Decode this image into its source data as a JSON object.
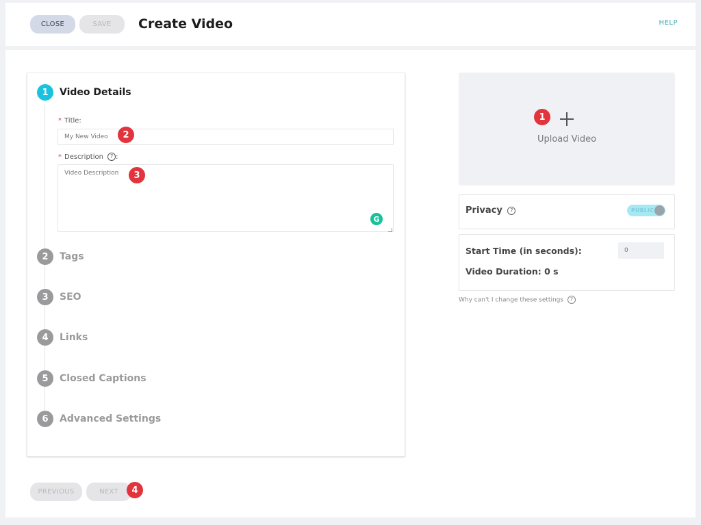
{
  "header": {
    "close_label": "CLOSE",
    "save_label": "SAVE",
    "title": "Create Video",
    "help_label": "HELP"
  },
  "steps": [
    {
      "number": "1",
      "label": "Video Details",
      "active": true
    },
    {
      "number": "2",
      "label": "Tags",
      "active": false
    },
    {
      "number": "3",
      "label": "SEO",
      "active": false
    },
    {
      "number": "4",
      "label": "Links",
      "active": false
    },
    {
      "number": "5",
      "label": "Closed Captions",
      "active": false
    },
    {
      "number": "6",
      "label": "Advanced Settings",
      "active": false
    }
  ],
  "form": {
    "required_marker": "*",
    "title_label": "Title:",
    "title_placeholder": "My New Video",
    "description_label": "Description",
    "description_suffix": ":",
    "description_placeholder": "Video Description",
    "help_icon": "?",
    "grammarly_icon": "G"
  },
  "upload": {
    "label": "Upload Video"
  },
  "privacy": {
    "label": "Privacy",
    "toggle_text": "PUBLIC",
    "toggle_on": true
  },
  "timing": {
    "start_time_label": "Start Time (in seconds):",
    "start_time_value": "0",
    "duration_label": "Video Duration: 0 s"
  },
  "why_link": "Why can't I change these settings",
  "footer": {
    "previous_label": "PREVIOUS",
    "next_label": "NEXT"
  },
  "annotations": [
    "1",
    "2",
    "3",
    "4"
  ],
  "colors": {
    "accent": "#19c3de",
    "badge": "#e2343c",
    "inactive_step": "#9a9a9c",
    "grammarly": "#15c39a"
  }
}
